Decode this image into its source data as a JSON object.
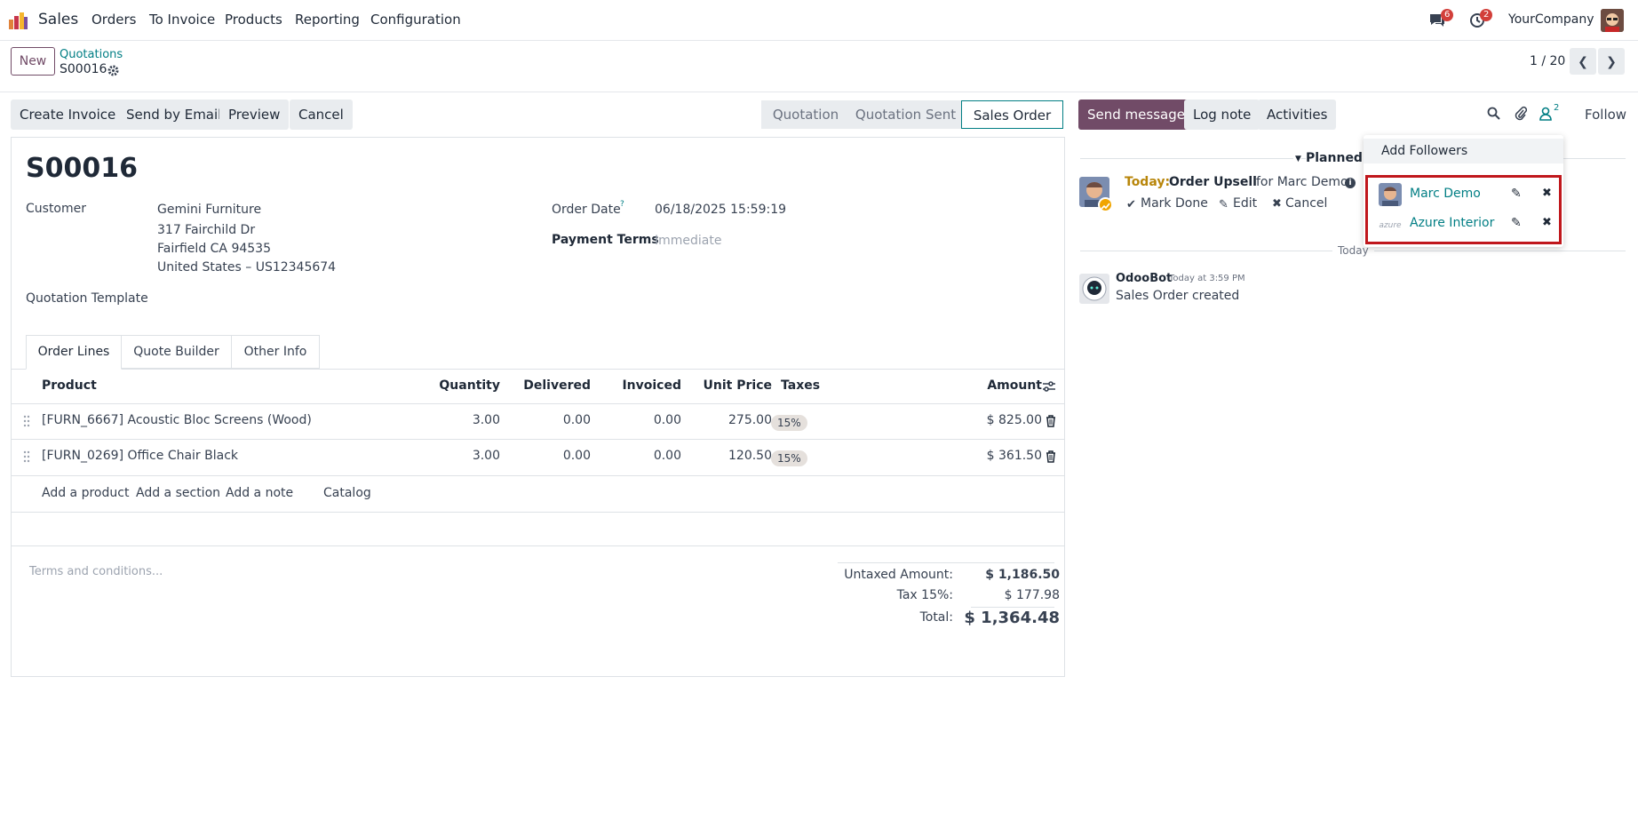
{
  "nav": {
    "app_name": "Sales",
    "menu": [
      "Orders",
      "To Invoice",
      "Products",
      "Reporting",
      "Configuration"
    ],
    "messages_count": "6",
    "activities_count": "2",
    "company": "YourCompany"
  },
  "control": {
    "new_label": "New",
    "breadcrumb_parent": "Quotations",
    "record_name": "S00016",
    "pager": "1 / 20"
  },
  "actions": {
    "create_invoice": "Create Invoice",
    "send_email": "Send by Email",
    "preview": "Preview",
    "cancel": "Cancel"
  },
  "stages": [
    "Quotation",
    "Quotation Sent",
    "Sales Order"
  ],
  "form": {
    "title": "S00016",
    "customer_label": "Customer",
    "customer_name": "Gemini Furniture",
    "address": [
      "317 Fairchild Dr",
      "Fairfield CA 94535",
      "United States – US12345674"
    ],
    "order_date_label": "Order Date",
    "order_date_help": "?",
    "order_date": "06/18/2025 15:59:19",
    "payment_terms_label": "Payment Terms",
    "payment_terms": "Immediate",
    "template_label": "Quotation Template",
    "tabs": [
      "Order Lines",
      "Quote Builder",
      "Other Info"
    ],
    "columns": [
      "Product",
      "Quantity",
      "Delivered",
      "Invoiced",
      "Unit Price",
      "Taxes",
      "Amount"
    ],
    "lines": [
      {
        "product": "[FURN_6667] Acoustic Bloc Screens (Wood)",
        "qty": "3.00",
        "delivered": "0.00",
        "invoiced": "0.00",
        "price": "275.00",
        "tax": "15%",
        "amount": "$ 825.00"
      },
      {
        "product": "[FURN_0269] Office Chair Black",
        "qty": "3.00",
        "delivered": "0.00",
        "invoiced": "0.00",
        "price": "120.50",
        "tax": "15%",
        "amount": "$ 361.50"
      }
    ],
    "add_links": [
      "Add a product",
      "Add a section",
      "Add a note",
      "Catalog"
    ],
    "terms_placeholder": "Terms and conditions...",
    "untaxed_label": "Untaxed Amount:",
    "untaxed": "$ 1,186.50",
    "tax_label": "Tax 15%:",
    "tax": "$ 177.98",
    "total_label": "Total:",
    "total": "$ 1,364.48"
  },
  "chatter": {
    "send_message": "Send message",
    "log_note": "Log note",
    "activities": "Activities",
    "followers_count": "2",
    "follow": "Follow",
    "planned_label": "Planned A",
    "activity_today": "Today:",
    "activity_title": "Order Upsell",
    "activity_for": "for Marc Demo",
    "mark_done": "Mark Done",
    "edit": "Edit",
    "cancel": "Cancel",
    "today_sep": "Today",
    "msg_author": "OdooBot",
    "msg_time": "Today at 3:59 PM",
    "msg_body": "Sales Order created"
  },
  "followers": {
    "add_label": "Add Followers",
    "list": [
      "Marc Demo",
      "Azure Interior"
    ],
    "azure_logo_text": "azure"
  },
  "colors": {
    "brand": "#714b67",
    "link": "#017e84",
    "highlight_box": "#c0171c",
    "today": "#b8860b"
  }
}
